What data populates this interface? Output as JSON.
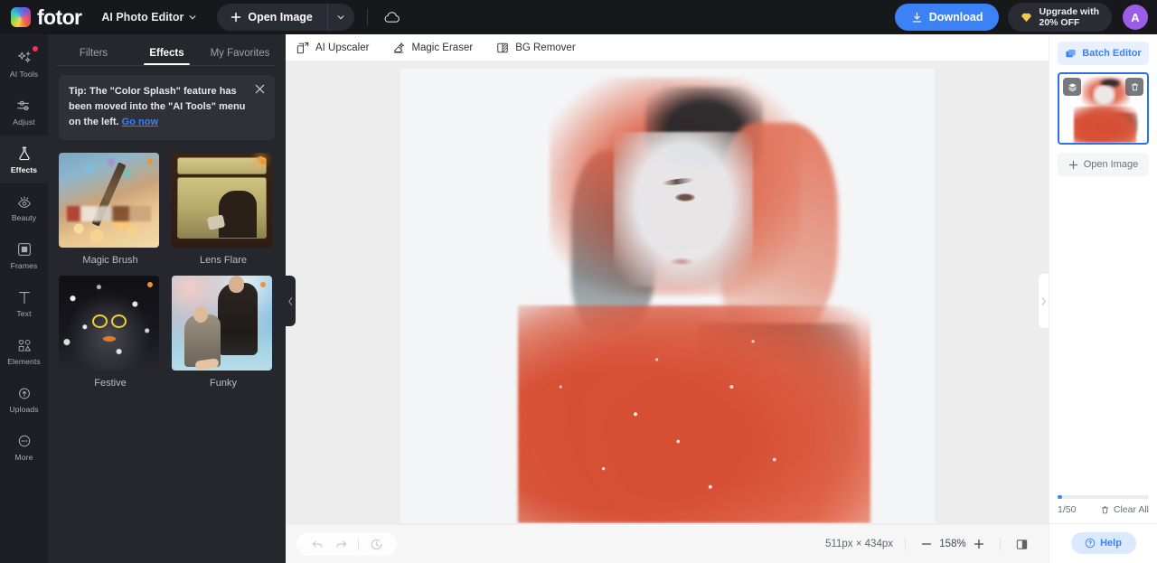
{
  "topbar": {
    "brand": "fotor",
    "app_switcher": "AI Photo Editor",
    "open_image": "Open Image",
    "download": "Download",
    "upgrade_line1": "Upgrade with",
    "upgrade_line2": "20% OFF",
    "avatar_initial": "A",
    "accent_blue": "#3b82f6",
    "avatar_color": "#9b5de5"
  },
  "sidebar": {
    "items": [
      {
        "label": "AI Tools",
        "icon": "sparkles-icon",
        "active": false,
        "badge": true
      },
      {
        "label": "Adjust",
        "icon": "sliders-icon",
        "active": false,
        "badge": false
      },
      {
        "label": "Effects",
        "icon": "flask-icon",
        "active": true,
        "badge": false
      },
      {
        "label": "Beauty",
        "icon": "eye-icon",
        "active": false,
        "badge": false
      },
      {
        "label": "Frames",
        "icon": "frame-icon",
        "active": false,
        "badge": false
      },
      {
        "label": "Text",
        "icon": "text-icon",
        "active": false,
        "badge": false
      },
      {
        "label": "Elements",
        "icon": "shapes-icon",
        "active": false,
        "badge": false
      },
      {
        "label": "Uploads",
        "icon": "upload-cloud-icon",
        "active": false,
        "badge": false
      },
      {
        "label": "More",
        "icon": "more-dots-icon",
        "active": false,
        "badge": false
      }
    ]
  },
  "panel": {
    "tabs": [
      {
        "label": "Filters",
        "active": false
      },
      {
        "label": "Effects",
        "active": true
      },
      {
        "label": "My Favorites",
        "active": false
      }
    ],
    "tip": {
      "text_part1": "Tip: The \"Color Splash\" feature has been moved into the \"AI Tools\" menu on the left.",
      "link": "Go now"
    },
    "effects": [
      {
        "label": "Magic Brush",
        "art": "brush"
      },
      {
        "label": "Lens Flare",
        "art": "flare"
      },
      {
        "label": "Festive",
        "art": "festive"
      },
      {
        "label": "Funky",
        "art": "funky"
      }
    ]
  },
  "center": {
    "tools": [
      {
        "label": "AI Upscaler",
        "icon": "upscale-icon"
      },
      {
        "label": "Magic Eraser",
        "icon": "eraser-icon"
      },
      {
        "label": "BG Remover",
        "icon": "bg-remover-icon"
      }
    ],
    "bottom": {
      "dimensions": "511px × 434px",
      "zoom": "158%",
      "undo_icon": "undo-icon",
      "redo_icon": "redo-icon",
      "history_icon": "history-icon",
      "compare_icon": "compare-icon"
    }
  },
  "rightpanel": {
    "batch_editor": "Batch Editor",
    "open_image": "Open Image",
    "count": "1/50",
    "clear_all": "Clear All",
    "help": "Help",
    "thumb_layers_icon": "layers-icon",
    "thumb_delete_icon": "trash-icon"
  }
}
